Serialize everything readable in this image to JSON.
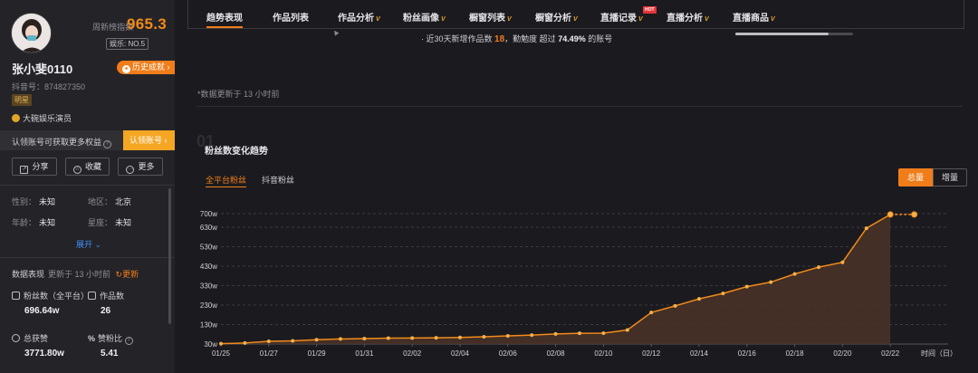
{
  "profile": {
    "name": "张小斐0110",
    "douyin_id": "抖音号：874827350",
    "tag": "明星",
    "company": "大碗娱乐演员",
    "rank_label": "周新榜指数",
    "rank_value": "965.3",
    "rank_badge": "娱乐: NO.5",
    "history_button": "历史成就"
  },
  "claim": {
    "text": "认领账号可获取更多权益",
    "button": "认领账号"
  },
  "actions": {
    "share": "分享",
    "collect": "收藏",
    "more": "更多"
  },
  "info": {
    "gender_label": "性别：",
    "gender": "未知",
    "region_label": "地区：",
    "region": "北京",
    "age_label": "年龄：",
    "age": "未知",
    "zodiac_label": "星座：",
    "zodiac": "未知",
    "expand": "展开"
  },
  "data_overview": {
    "title": "数据表现",
    "updated": "更新于 13 小时前",
    "refresh": "更新",
    "fans_label": "粉丝数（全平台）",
    "fans_value": "696.64w",
    "works_label": "作品数",
    "works_value": "26",
    "likes_label": "总获赞",
    "likes_value": "3771.80w",
    "ratio_label": "赞粉比",
    "ratio_value": "5.41"
  },
  "tabs": [
    {
      "label": "趋势表现",
      "vip": ""
    },
    {
      "label": "作品列表",
      "vip": ""
    },
    {
      "label": "作品分析",
      "vip": "V"
    },
    {
      "label": "粉丝画像",
      "vip": "V"
    },
    {
      "label": "橱窗列表",
      "vip": "V"
    },
    {
      "label": "橱窗分析",
      "vip": "V"
    },
    {
      "label": "直播记录",
      "vip": "V"
    },
    {
      "label": "直播分析",
      "vip": "V"
    },
    {
      "label": "直播商品",
      "vip": "V"
    }
  ],
  "hot_badge": "HOT",
  "summary": {
    "prefix": "· 近30天新增作品数",
    "works": "18",
    "mid": "，勤勉度 超过",
    "percent": "74.49%",
    "suffix": "的账号"
  },
  "update_note": "*数据更新于 13 小时前",
  "section": {
    "number": "01",
    "title": "粉丝数变化趋势",
    "sub_tabs": [
      "全平台粉丝",
      "抖音粉丝"
    ],
    "toggle_total": "总量",
    "toggle_increment": "增量"
  },
  "chart_data": {
    "type": "area",
    "xlabel": "时间（日）",
    "ylabel": "",
    "y_tick_labels": [
      "30w",
      "130w",
      "230w",
      "330w",
      "430w",
      "530w",
      "630w",
      "700w"
    ],
    "y_tick_values": [
      30,
      130,
      230,
      330,
      430,
      530,
      630,
      700
    ],
    "ylim": [
      30,
      700
    ],
    "grid": true,
    "colors": {
      "line": "#f28a1a",
      "fill": "#4a3328",
      "point": "#f5b04a"
    },
    "x_tick_labels": [
      "01/25",
      "01/27",
      "01/29",
      "01/31",
      "02/02",
      "02/04",
      "02/06",
      "02/08",
      "02/10",
      "02/12",
      "02/14",
      "02/16",
      "02/18",
      "02/20",
      "02/22"
    ],
    "x": [
      "01/25",
      "01/26",
      "01/27",
      "01/28",
      "01/29",
      "01/30",
      "01/31",
      "02/01",
      "02/02",
      "02/03",
      "02/04",
      "02/05",
      "02/06",
      "02/07",
      "02/08",
      "02/09",
      "02/10",
      "02/11",
      "02/12",
      "02/13",
      "02/14",
      "02/15",
      "02/16",
      "02/17",
      "02/18",
      "02/19",
      "02/20",
      "02/21",
      "02/22",
      "02/23"
    ],
    "series": [
      {
        "values": [
          32,
          35,
          44,
          46,
          52,
          56,
          58,
          60,
          61,
          62,
          64,
          67,
          72,
          76,
          82,
          85,
          86,
          102,
          192,
          226,
          262,
          290,
          325,
          348,
          390,
          425,
          450,
          625,
          696,
          696
        ],
        "projected_from_index": 28
      }
    ]
  }
}
